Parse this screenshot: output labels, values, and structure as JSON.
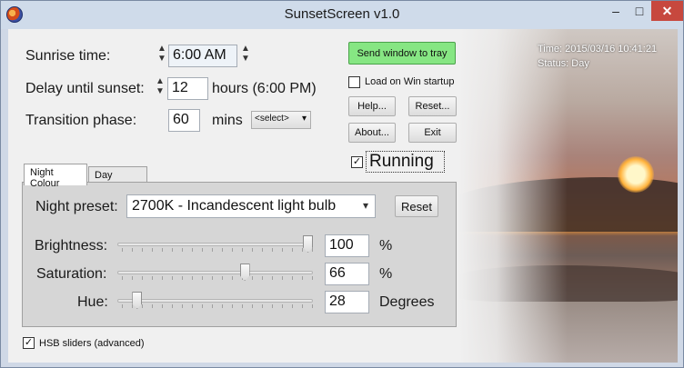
{
  "window": {
    "title": "SunsetScreen v1.0",
    "minimize": "–",
    "maximize": "□",
    "close": "✕"
  },
  "status": {
    "time": "Time: 2015/03/16 10:41:21",
    "status": "Status: Day"
  },
  "schedule": {
    "sunrise_label": "Sunrise time:",
    "sunrise_value": "6:00 AM",
    "delay_label": "Delay until sunset:",
    "delay_value": "12",
    "delay_unit": "hours  (6:00 PM)",
    "transition_label": "Transition phase:",
    "transition_value": "60",
    "transition_unit": "mins",
    "transition_select": "<select>"
  },
  "actions": {
    "send_to_tray": "Send window to tray",
    "load_on_startup": "Load on Win startup",
    "load_on_startup_checked": false,
    "help": "Help...",
    "reset": "Reset...",
    "about": "About...",
    "exit": "Exit",
    "running": "Running",
    "running_checked": true
  },
  "tabs": [
    {
      "label": "Night Colour",
      "active": true
    },
    {
      "label": "Day Colour",
      "active": false
    }
  ],
  "night": {
    "preset_label": "Night preset:",
    "preset_value": "2700K - Incandescent light bulb",
    "reset": "Reset",
    "sliders": [
      {
        "label": "Brightness:",
        "value": "100",
        "unit": "%",
        "level": 1.0
      },
      {
        "label": "Saturation:",
        "value": "66",
        "unit": "%",
        "level": 0.66
      },
      {
        "label": "Hue:",
        "value": "28",
        "unit": "Degrees",
        "level": 0.08
      }
    ]
  },
  "hsb_sliders": {
    "label": "HSB sliders (advanced)",
    "checked": true
  },
  "glyphs": {
    "spin_up": "▲",
    "spin_down": "▼",
    "dropdown": "▾",
    "check": "✓"
  }
}
